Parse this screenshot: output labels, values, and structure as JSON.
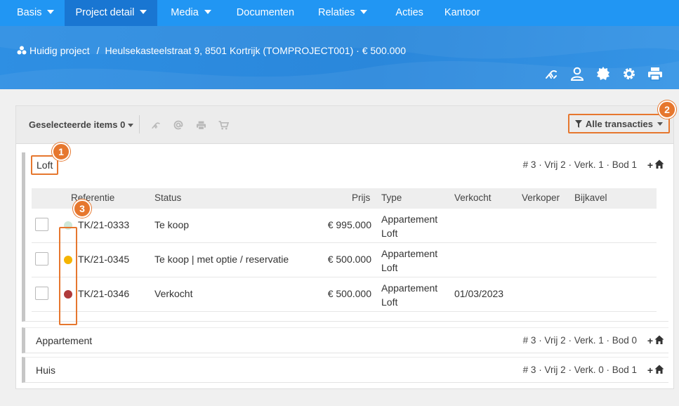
{
  "nav": {
    "items": [
      {
        "label": "Basis",
        "dropdown": true,
        "active": false
      },
      {
        "label": "Project detail",
        "dropdown": true,
        "active": true
      },
      {
        "label": "Media",
        "dropdown": true,
        "active": false
      },
      {
        "label": "Documenten",
        "dropdown": false,
        "active": false
      },
      {
        "label": "Relaties",
        "dropdown": true,
        "active": false
      },
      {
        "label": "Acties",
        "dropdown": false,
        "active": false
      },
      {
        "label": "Kantoor",
        "dropdown": false,
        "active": false
      }
    ]
  },
  "breadcrumb": {
    "root": "Huidig project",
    "separator": "/",
    "current": "Heulsekasteelstraat 9, 8501 Kortrijk (TOMPROJECT001) · € 500.000"
  },
  "header_icons": [
    "handshake-icon",
    "user-icon",
    "certificate-icon",
    "gear-icon",
    "print-icon"
  ],
  "toolbar": {
    "selected_label": "Geselecteerde items 0",
    "icons": [
      "handshake-icon",
      "at-icon",
      "print-icon",
      "cart-icon"
    ],
    "filter_label": "Alle transacties"
  },
  "groups": [
    {
      "title": "Loft",
      "stats": "# 3 · Vrij 2 · Verk. 1 · Bod 1",
      "add_label": "+"
    },
    {
      "title": "Appartement",
      "stats": "# 3 · Vrij 2 · Verk. 1 · Bod 0",
      "add_label": "+"
    },
    {
      "title": "Huis",
      "stats": "# 3 · Vrij 2 · Verk. 0 · Bod 1",
      "add_label": "+"
    }
  ],
  "table": {
    "headers": {
      "referentie": "Referentie",
      "status": "Status",
      "prijs": "Prijs",
      "type": "Type",
      "verkocht": "Verkocht",
      "verkoper": "Verkoper",
      "bijkavel": "Bijkavel"
    },
    "rows": [
      {
        "color": "#cfe8d9",
        "ref": "TK/21-0333",
        "status": "Te koop",
        "prijs": "€ 995.000",
        "type1": "Appartement",
        "type2": "Loft",
        "verkocht": "",
        "verkoper": "",
        "bijkavel": ""
      },
      {
        "color": "#f5b400",
        "ref": "TK/21-0345",
        "status": "Te koop | met optie / reservatie",
        "prijs": "€ 500.000",
        "type1": "Appartement",
        "type2": "Loft",
        "verkocht": "",
        "verkoper": "",
        "bijkavel": ""
      },
      {
        "color": "#b03a3a",
        "ref": "TK/21-0346",
        "status": "Verkocht",
        "prijs": "€ 500.000",
        "type1": "Appartement",
        "type2": "Loft",
        "verkocht": "01/03/2023",
        "verkoper": "",
        "bijkavel": ""
      }
    ]
  },
  "badges": [
    "1",
    "2",
    "3"
  ],
  "colors": {
    "nav": "#2196f3",
    "nav_active": "#1976d2",
    "highlight": "#e6772e"
  }
}
